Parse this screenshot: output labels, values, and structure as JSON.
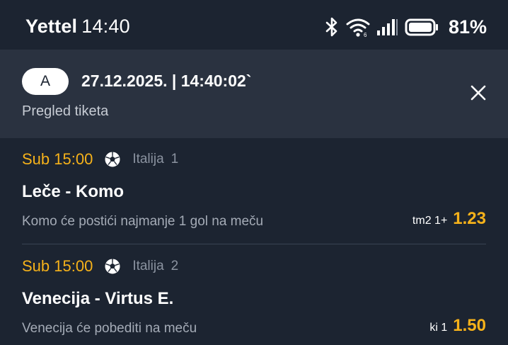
{
  "status_bar": {
    "carrier": "Yettel",
    "time": "14:40",
    "battery_percent": "81%",
    "icons": [
      "bluetooth-icon",
      "wifi-icon",
      "signal-icon",
      "battery-icon"
    ],
    "battery_level": 0.81
  },
  "header": {
    "pill_label": "A",
    "datetime": "27.12.2025. | 14:40:02`",
    "subtitle": "Pregled tiketa",
    "close_icon": "close-icon"
  },
  "bets": [
    {
      "time": "Sub 15:00",
      "sport_icon": "soccer-ball-icon",
      "league": "Italija",
      "round": "1",
      "match": "Leče - Komo",
      "description": "Komo će postići najmanje 1 gol na meču",
      "pick_code": "tm2 1+",
      "odds": "1.23"
    },
    {
      "time": "Sub 15:00",
      "sport_icon": "soccer-ball-icon",
      "league": "Italija",
      "round": "2",
      "match": "Venecija - Virtus E.",
      "description": "Venecija će pobediti na meču",
      "pick_code": "ki 1",
      "odds": "1.50"
    }
  ],
  "colors": {
    "background": "#1c2431",
    "header_background": "#2a3240",
    "accent": "#f6b21a",
    "muted_text": "#8b93a0"
  }
}
